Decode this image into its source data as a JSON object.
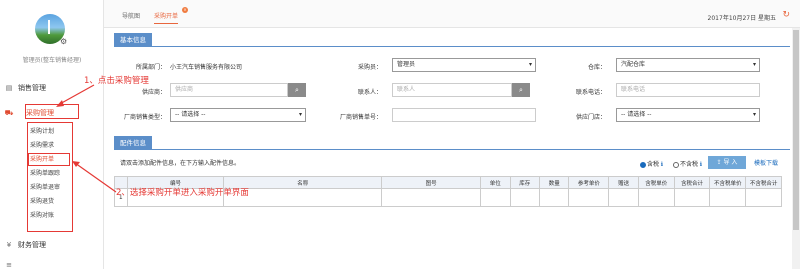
{
  "sidebar": {
    "user_name": "管理员(整车销售经理)",
    "sections": [
      {
        "label": "销售管理",
        "icon": "document-icon"
      },
      {
        "label": "采购管理",
        "icon": "cart-icon"
      },
      {
        "label": "财务管理",
        "icon": "yen-icon"
      }
    ],
    "purchase_items": [
      "采购计划",
      "采购需求",
      "采购开单",
      "采购单跟踪",
      "采购单退审",
      "采购退货",
      "采购对账"
    ]
  },
  "topbar": {
    "tabs": [
      "导航图",
      "采购开单"
    ],
    "tab_badge": "×",
    "date": "2017年10月27日 星期五"
  },
  "basic_info": {
    "header": "基本信息",
    "dept_label": "所属部门：",
    "dept_value": "小王汽车销售服务有限公司",
    "buyer_label": "采购员：",
    "buyer_value": "管理员",
    "warehouse_label": "仓库：",
    "warehouse_value": "汽配仓库",
    "supplier_label": "供应商：",
    "supplier_placeholder": "供应商",
    "contact_label": "联系人：",
    "contact_placeholder": "联系人",
    "phone_label": "联系电话：",
    "phone_placeholder": "联系电话",
    "mfr_type_label": "厂商销售类型：",
    "mfr_type_value": "-- 请选择 --",
    "mfr_order_label": "厂商销售单号：",
    "store_label": "供应门店：",
    "store_value": "-- 请选择 --"
  },
  "parts_info": {
    "header": "配件信息",
    "hint": "请双击添加配件信息，在下方输入配件信息。",
    "radio_tax": "含税",
    "radio_untax": "不含税",
    "import_label": "导 入",
    "template_link": "模板下载",
    "columns": [
      "",
      "编号",
      "名称",
      "图号",
      "单位",
      "库存",
      "数量",
      "参考单价",
      "赠送",
      "含税单价",
      "含税合计",
      "不含税单价",
      "不含税合计"
    ],
    "row_no": "1"
  },
  "annotations": {
    "step1": "1、点击采购管理",
    "step2": "2、选择采购开单进入采购开单界面"
  },
  "colors": {
    "accent": "#e8663d",
    "header_blue": "#5b8ec9",
    "annotation_red": "#e53935"
  }
}
